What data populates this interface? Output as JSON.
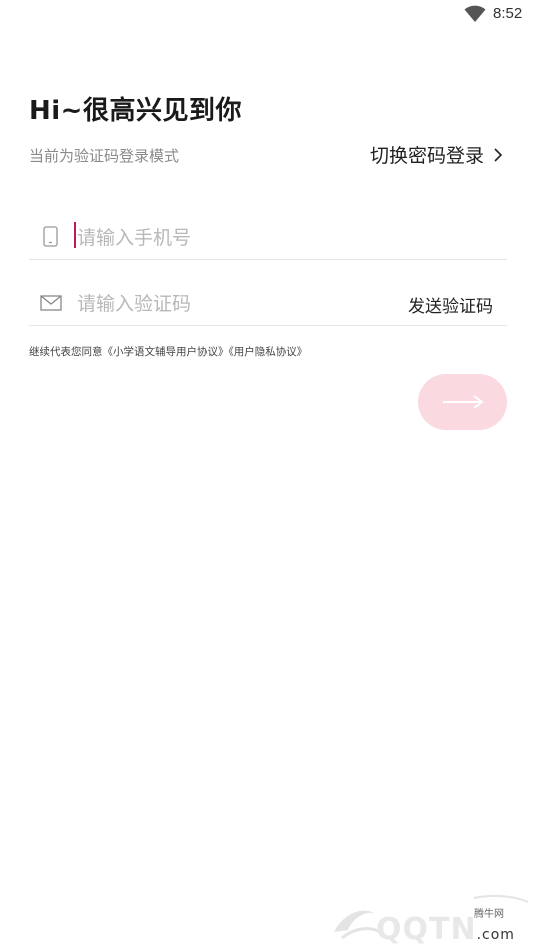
{
  "status_bar": {
    "time": "8:52",
    "wifi_icon": "wifi-icon"
  },
  "header": {
    "greeting": "Hi~很高兴见到你",
    "mode_hint": "当前为验证码登录模式",
    "switch_label": "切换密码登录"
  },
  "form": {
    "phone_placeholder": "请输入手机号",
    "phone_value": "",
    "code_placeholder": "请输入验证码",
    "code_value": "",
    "send_code_label": "发送验证码"
  },
  "agreement": "继续代表您同意《小学语文辅导用户协议》《用户隐私协议》",
  "colors": {
    "accent": "#c2185b",
    "submit_bg": "#fbd9e1"
  },
  "watermark": {
    "brand": "QQTN",
    "domain_suffix": ".com",
    "site_name": "腾牛网"
  }
}
